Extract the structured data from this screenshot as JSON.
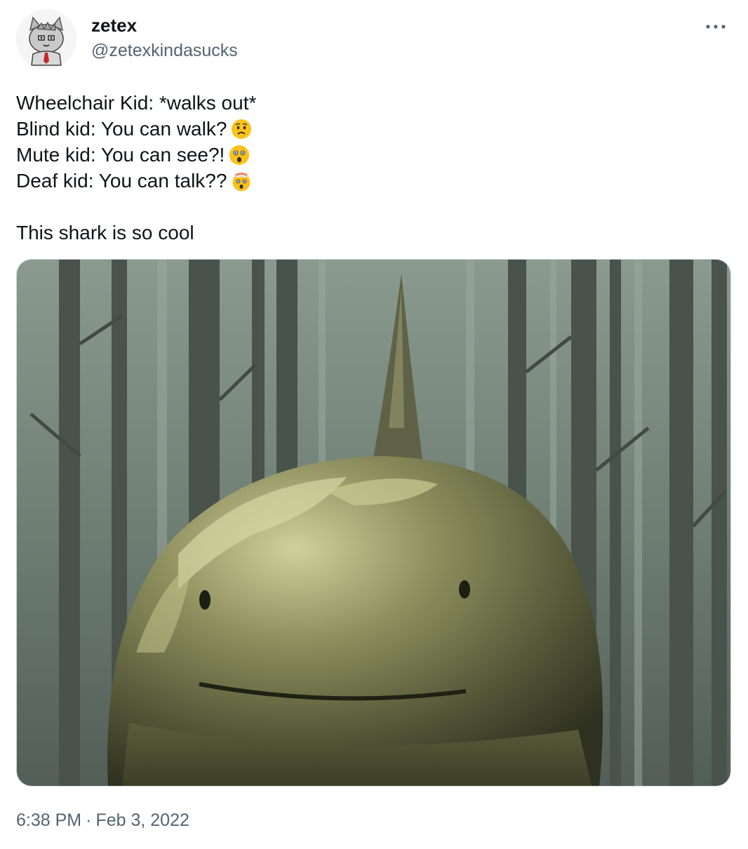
{
  "author": {
    "name": "zetex",
    "handle": "@zetexkindasucks",
    "avatar_icon": "cartoon-cat-avatar-icon"
  },
  "menu": {
    "icon": "more-horizontal-icon"
  },
  "tweet": {
    "lines": [
      {
        "text": "Wheelchair Kid: *walks out*",
        "emoji": ""
      },
      {
        "text": "Blind kid: You can walk?",
        "emoji": "worried-face"
      },
      {
        "text": "Mute kid: You can see?!",
        "emoji": "astonished-face"
      },
      {
        "text": "Deaf kid: You can talk??",
        "emoji": "exploding-head"
      }
    ],
    "closing": "This shark is so cool"
  },
  "media": {
    "description_icon": "shark-in-forest-image"
  },
  "meta": {
    "time": "6:38 PM",
    "separator": "·",
    "date": "Feb 3, 2022"
  },
  "colors": {
    "text_primary": "#0f1419",
    "text_secondary": "#536471",
    "border": "#cfd9de"
  }
}
